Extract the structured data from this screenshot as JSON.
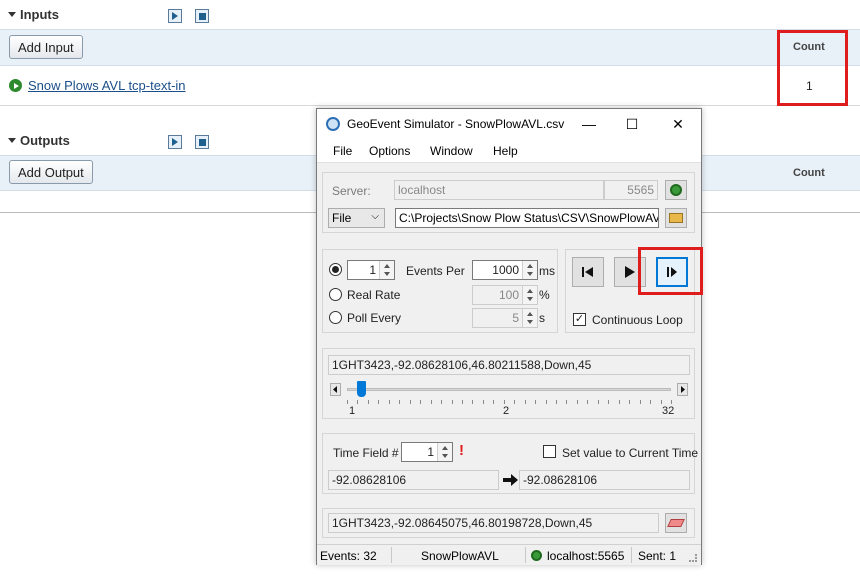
{
  "manager": {
    "inputs_title": "Inputs",
    "outputs_title": "Outputs",
    "add_input_label": "Add Input",
    "add_output_label": "Add Output",
    "count_header": "Count",
    "input_row": {
      "name": "Snow Plows AVL tcp-text-in",
      "count": "1",
      "status_icon": "running-icon"
    },
    "icons": {
      "start": "play-icon",
      "stop": "stop-icon"
    }
  },
  "simulator": {
    "title": "GeoEvent Simulator - SnowPlowAVL.csv",
    "window_controls": {
      "minimize": "—",
      "maximize": "☐",
      "close": "✕"
    },
    "menu": [
      "File",
      "Options",
      "Window",
      "Help"
    ],
    "server": {
      "label": "Server:",
      "host": "localhost",
      "port": "5565"
    },
    "source": {
      "type": "File",
      "path": "C:\\Projects\\Snow Plow Status\\CSV\\SnowPlowAVL.csv"
    },
    "rate": {
      "events_count": "1",
      "events_label": "Events Per",
      "events_ms": "1000",
      "ms_unit": "ms",
      "real_rate_label": "Real Rate",
      "real_rate_value": "100",
      "percent_unit": "%",
      "poll_label": "Poll Every",
      "poll_value": "5",
      "sec_unit": "s"
    },
    "playback": {
      "continuous_loop_label": "Continuous Loop",
      "continuous_loop_checked": "✓"
    },
    "event_line": "1GHT3423,-92.08628106,46.80211588,Down,45",
    "slider": {
      "min_label": "1",
      "mid_label": "2",
      "max_label": "32",
      "position": 0.03
    },
    "time_field": {
      "label": "Time Field #",
      "value": "1",
      "warning": "!",
      "set_current_label": "Set value to Current Time",
      "from_value": "-92.08628106",
      "to_value": "-92.08628106"
    },
    "last_sent": "1GHT3423,-92.08645075,46.80198728,Down,45",
    "status": {
      "events": "Events: 32",
      "name": "SnowPlowAVL",
      "server": "localhost:5565",
      "sent": "Sent: 1"
    }
  }
}
